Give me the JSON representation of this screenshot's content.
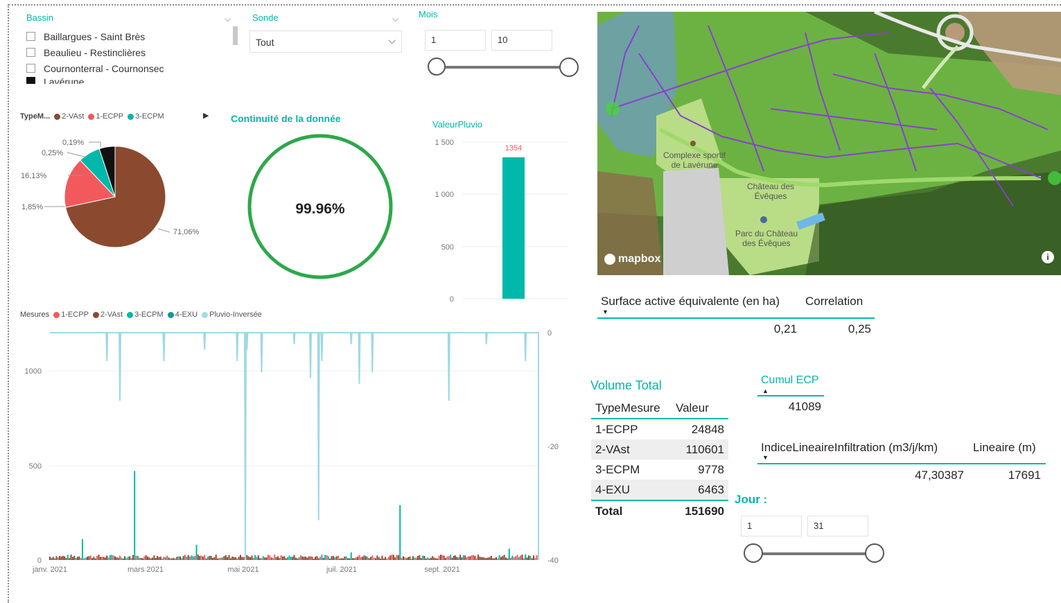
{
  "bassin": {
    "title": "Bassin",
    "items": [
      "Baillargues - Saint Brès",
      "Beaulieu - Restinclières",
      "Cournonterral - Cournonsec",
      "Lavérune"
    ]
  },
  "sonde": {
    "title": "Sonde",
    "value": "Tout"
  },
  "mois": {
    "title": "Mois",
    "min": "1",
    "max": "10"
  },
  "pie": {
    "legend_title": "TypeM...",
    "legend": [
      {
        "name": "2-VAst",
        "color": "#8b4a2f"
      },
      {
        "name": "1-ECPP",
        "color": "#f2595c"
      },
      {
        "name": "3-ECPM",
        "color": "#01b8aa"
      }
    ],
    "labels": {
      "vast": "71,06%",
      "ecpp": "16,13%",
      "ecpm": "1,85%",
      "black": "0,25%",
      "small": "0,19%"
    }
  },
  "continuite": {
    "title": "Continuité de la donnée",
    "value": "99.96%",
    "fraction": 0.9996
  },
  "pluvio": {
    "title": "ValeurPluvio",
    "ticks": [
      "1 500",
      "1 000",
      "500",
      "0"
    ],
    "bar_label": "1354"
  },
  "chart_data": [
    {
      "type": "pie",
      "slices": [
        {
          "name": "2-VAst",
          "value": 71.06,
          "color": "#8b4a2f"
        },
        {
          "name": "1-ECPP",
          "value": 16.13,
          "color": "#f2595c"
        },
        {
          "name": "3-ECPM",
          "value": 7.0,
          "color": "#01b8aa"
        },
        {
          "name": "",
          "value": 5.0,
          "color": "#111111"
        }
      ]
    },
    {
      "type": "bar",
      "title": "ValeurPluvio",
      "categories": [
        ""
      ],
      "values": [
        1354
      ],
      "ylim": [
        0,
        1500
      ],
      "color": "#01b8aa"
    },
    {
      "type": "line",
      "legend_title": "Mesures",
      "series_names": [
        "1-ECPP",
        "2-VAst",
        "3-ECPM",
        "4-EXU",
        "Pluvio-Inversée"
      ],
      "series_colors": [
        "#f2595c",
        "#8b4a2f",
        "#01b8aa",
        "#0a9d8f",
        "#a3dce7"
      ],
      "x_ticks": [
        "janv. 2021",
        "mars 2021",
        "mai 2021",
        "juil. 2021",
        "sept. 2021"
      ],
      "y_ticks_left": [
        "1000",
        "500",
        "0"
      ],
      "y_ticks_right": [
        "0",
        "-20",
        "-40"
      ],
      "ylim_left": [
        0,
        1200
      ],
      "ylim_right": [
        -40,
        0
      ],
      "pluvio_spikes": [
        {
          "day": 35,
          "v": -5
        },
        {
          "day": 43,
          "v": -12
        },
        {
          "day": 70,
          "v": -5
        },
        {
          "day": 95,
          "v": -3
        },
        {
          "day": 115,
          "v": -5
        },
        {
          "day": 120,
          "v": -40
        },
        {
          "day": 121,
          "v": -3
        },
        {
          "day": 130,
          "v": -7
        },
        {
          "day": 150,
          "v": -2
        },
        {
          "day": 160,
          "v": -8
        },
        {
          "day": 165,
          "v": -33
        },
        {
          "day": 167,
          "v": -5
        },
        {
          "day": 185,
          "v": -2
        },
        {
          "day": 190,
          "v": -9
        },
        {
          "day": 198,
          "v": -7
        },
        {
          "day": 245,
          "v": -12
        },
        {
          "day": 268,
          "v": -2
        },
        {
          "day": 292,
          "v": -5
        }
      ],
      "flow_spikes": [
        {
          "day": 20,
          "v": 110
        },
        {
          "day": 52,
          "v": 470
        },
        {
          "day": 90,
          "v": 80
        },
        {
          "day": 120,
          "v": 1180
        },
        {
          "day": 185,
          "v": 40
        },
        {
          "day": 215,
          "v": 290
        },
        {
          "day": 282,
          "v": 60
        },
        {
          "day": 292,
          "v": 30
        }
      ]
    }
  ],
  "mesures": {
    "legend_title": "Mesures",
    "legend": [
      {
        "name": "1-ECPP",
        "color": "#f2595c"
      },
      {
        "name": "2-VAst",
        "color": "#8b4a2f"
      },
      {
        "name": "3-ECPM",
        "color": "#01b8aa"
      },
      {
        "name": "4-EXU",
        "color": "#0a9d8f"
      },
      {
        "name": "Pluvio-Inversée",
        "color": "#a3dce7"
      }
    ]
  },
  "map": {
    "labels": [
      "Complexe sportif de Lavérune",
      "Château des Évêques",
      "Parc du Château des Évêques"
    ],
    "brand": "mapbox"
  },
  "surface": {
    "col1": "Surface active équivalente (en ha)",
    "col2": "Correlation",
    "v1": "0,21",
    "v2": "0,25"
  },
  "volume": {
    "title": "Volume Total",
    "headers": [
      "TypeMesure",
      "Valeur"
    ],
    "rows": [
      {
        "type": "1-ECPP",
        "value": "24848"
      },
      {
        "type": "2-VAst",
        "value": "110601"
      },
      {
        "type": "3-ECPM",
        "value": "9778"
      },
      {
        "type": "4-EXU",
        "value": "6463"
      }
    ],
    "total_label": "Total",
    "total_value": "151690"
  },
  "cumul": {
    "title": "Cumul ECP",
    "value": "41089"
  },
  "indice": {
    "col1": "IndiceLineaireInfiltration (m3/j/km)",
    "col2": "Lineaire (m)",
    "v1": "47,30387",
    "v2": "17691"
  },
  "jour": {
    "title": "Jour :",
    "min": "1",
    "max": "31"
  }
}
